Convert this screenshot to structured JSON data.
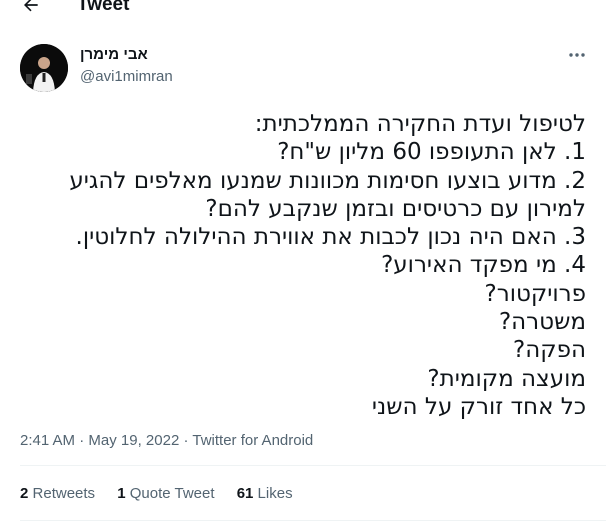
{
  "header": {
    "title": "Tweet",
    "back_icon": "arrow-left-icon"
  },
  "author": {
    "name": "אבי מימרן",
    "handle": "@avi1mimran"
  },
  "tweet_lines": [
    "לטיפול ועדת החקירה הממלכתית:",
    "1. לאן התעופפו 60 מליון ש\"ח?",
    "2. מדוע בוצעו חסימות מכוונות שמנעו מאלפים להגיע",
    "למירון עם כרטיסים ובזמן שנקבע להם?",
    "3. האם היה נכון לכבות את אווירת ההילולה לחלוטין.",
    "4. מי מפקד האירוע?",
    "פרויקטור?",
    "משטרה?",
    "הפקה?",
    "מועצה מקומית?",
    "כל אחד זורק על השני"
  ],
  "meta": {
    "time": "2:41 AM",
    "separator": "·",
    "date": "May 19, 2022",
    "source": "Twitter for Android"
  },
  "stats": {
    "retweets_count": "2",
    "retweets_label": "Retweets",
    "quotes_count": "1",
    "quotes_label": "Quote Tweet",
    "likes_count": "61",
    "likes_label": "Likes"
  },
  "colors": {
    "text": "#0f1419",
    "secondary": "#536471",
    "divider": "#eff3f4"
  }
}
